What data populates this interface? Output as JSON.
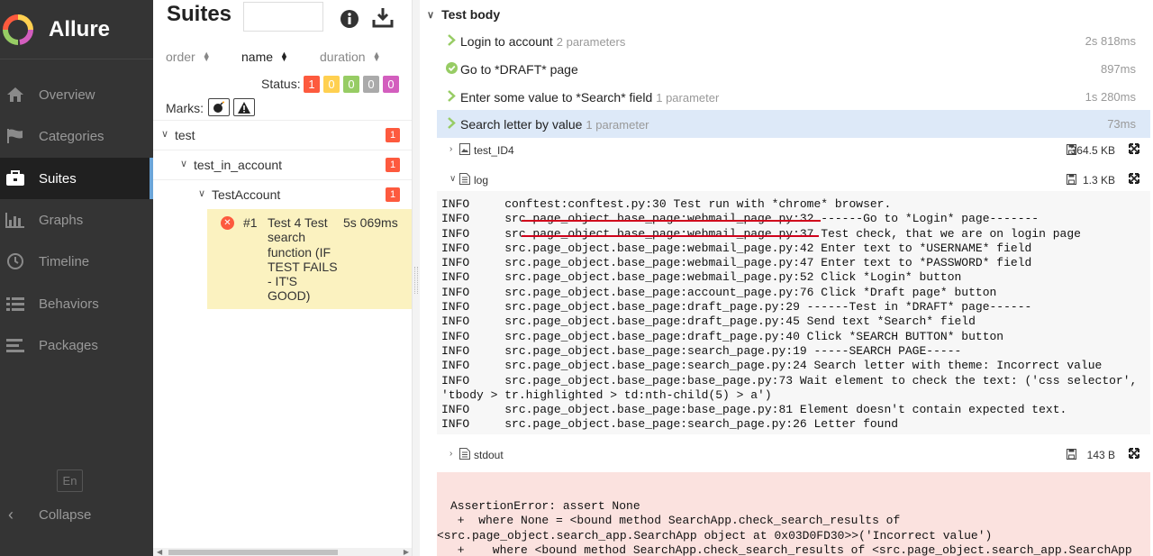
{
  "app": {
    "name": "Allure"
  },
  "colors": {
    "sidebar_bg": "#343434",
    "failed": "#fd5a3e",
    "broken": "#ffd050",
    "passed": "#97cc64",
    "skipped": "#aaaaaa",
    "unknown": "#d35ebe",
    "selected_step": "#dde9f8",
    "selected_case": "#fbf2c0",
    "error_bg": "#fbe2df"
  },
  "sidebar": {
    "items": [
      {
        "label": "Overview",
        "icon": "home-icon"
      },
      {
        "label": "Categories",
        "icon": "flag-icon"
      },
      {
        "label": "Suites",
        "icon": "briefcase-icon",
        "active": true
      },
      {
        "label": "Graphs",
        "icon": "bar-chart-icon"
      },
      {
        "label": "Timeline",
        "icon": "clock-icon"
      },
      {
        "label": "Behaviors",
        "icon": "list-icon"
      },
      {
        "label": "Packages",
        "icon": "align-left-icon"
      }
    ],
    "language": "En",
    "collapse": "Collapse"
  },
  "tree": {
    "title": "Suites",
    "search_value": "",
    "sorters": {
      "order": "order",
      "name": "name",
      "duration": "duration"
    },
    "status_label": "Status:",
    "status_counts": [
      "1",
      "0",
      "0",
      "0",
      "0"
    ],
    "marks_label": "Marks:",
    "rows": [
      {
        "label": "test",
        "count": "1"
      },
      {
        "label": "test_in_account",
        "count": "1"
      },
      {
        "label": "TestAccount",
        "count": "1"
      }
    ],
    "case": {
      "number": "#1",
      "name": "Test 4 Test search function (IF TEST FAILS - IT'S GOOD)",
      "duration": "5s 069ms"
    }
  },
  "main": {
    "section": "Test body",
    "steps": [
      {
        "title": "Login to account",
        "params": "2 parameters",
        "time": "2s 818ms",
        "status": "chevron"
      },
      {
        "title": "Go to *DRAFT* page",
        "params": "",
        "time": "897ms",
        "status": "passed"
      },
      {
        "title": "Enter some value to *Search* field",
        "params": "1 parameter",
        "time": "1s 280ms",
        "status": "chevron"
      },
      {
        "title": "Search letter by value",
        "params": "1 parameter",
        "time": "73ms",
        "status": "chevron"
      }
    ],
    "attachments": [
      {
        "name": "test_ID4",
        "size": "364.5 KB",
        "type": "image"
      },
      {
        "name": "log",
        "size": "1.3 KB",
        "type": "text"
      },
      {
        "name": "stdout",
        "size": "143 B",
        "type": "text"
      }
    ],
    "log_lines": [
      "INFO     conftest:conftest.py:30 Test run with *chrome* browser.",
      "INFO     src.page_object.base_page:webmail_page.py:32 ------Go to *Login* page-------",
      "INFO     src.page_object.base_page:webmail_page.py:37 Test check, that we are on login page",
      "INFO     src.page_object.base_page:webmail_page.py:42 Enter text to *USERNAME* field",
      "INFO     src.page_object.base_page:webmail_page.py:47 Enter text to *PASSWORD* field",
      "INFO     src.page_object.base_page:webmail_page.py:52 Click *Login* button",
      "INFO     src.page_object.base_page:account_page.py:76 Click *Draft page* button",
      "INFO     src.page_object.base_page:draft_page.py:29 ------Test in *DRAFT* page------",
      "INFO     src.page_object.base_page:draft_page.py:45 Send text *Search* field",
      "INFO     src.page_object.base_page:draft_page.py:40 Click *SEARCH BUTTON* button",
      "INFO     src.page_object.base_page:search_page.py:19 -----SEARCH PAGE-----",
      "INFO     src.page_object.base_page:search_page.py:24 Search letter with theme: Incorrect value",
      "INFO     src.page_object.base_page:base_page.py:73 Wait element to check the text: ('css selector',",
      "'tbody > tr.highlighted > td:nth-child(5) > a')",
      "INFO     src.page_object.base_page:base_page.py:81 Element doesn't contain expected text.",
      "INFO     src.page_object.base_page:search_page.py:26 Letter found"
    ],
    "error_lines": [
      "AssertionError: assert None",
      " +  where None = <bound method SearchApp.check_search_results of",
      "<src.page_object.search_app.SearchApp object at 0x03D0FD30>>('Incorrect value')",
      " +    where <bound method SearchApp.check_search_results of <src.page_object.search_app.SearchApp"
    ]
  }
}
